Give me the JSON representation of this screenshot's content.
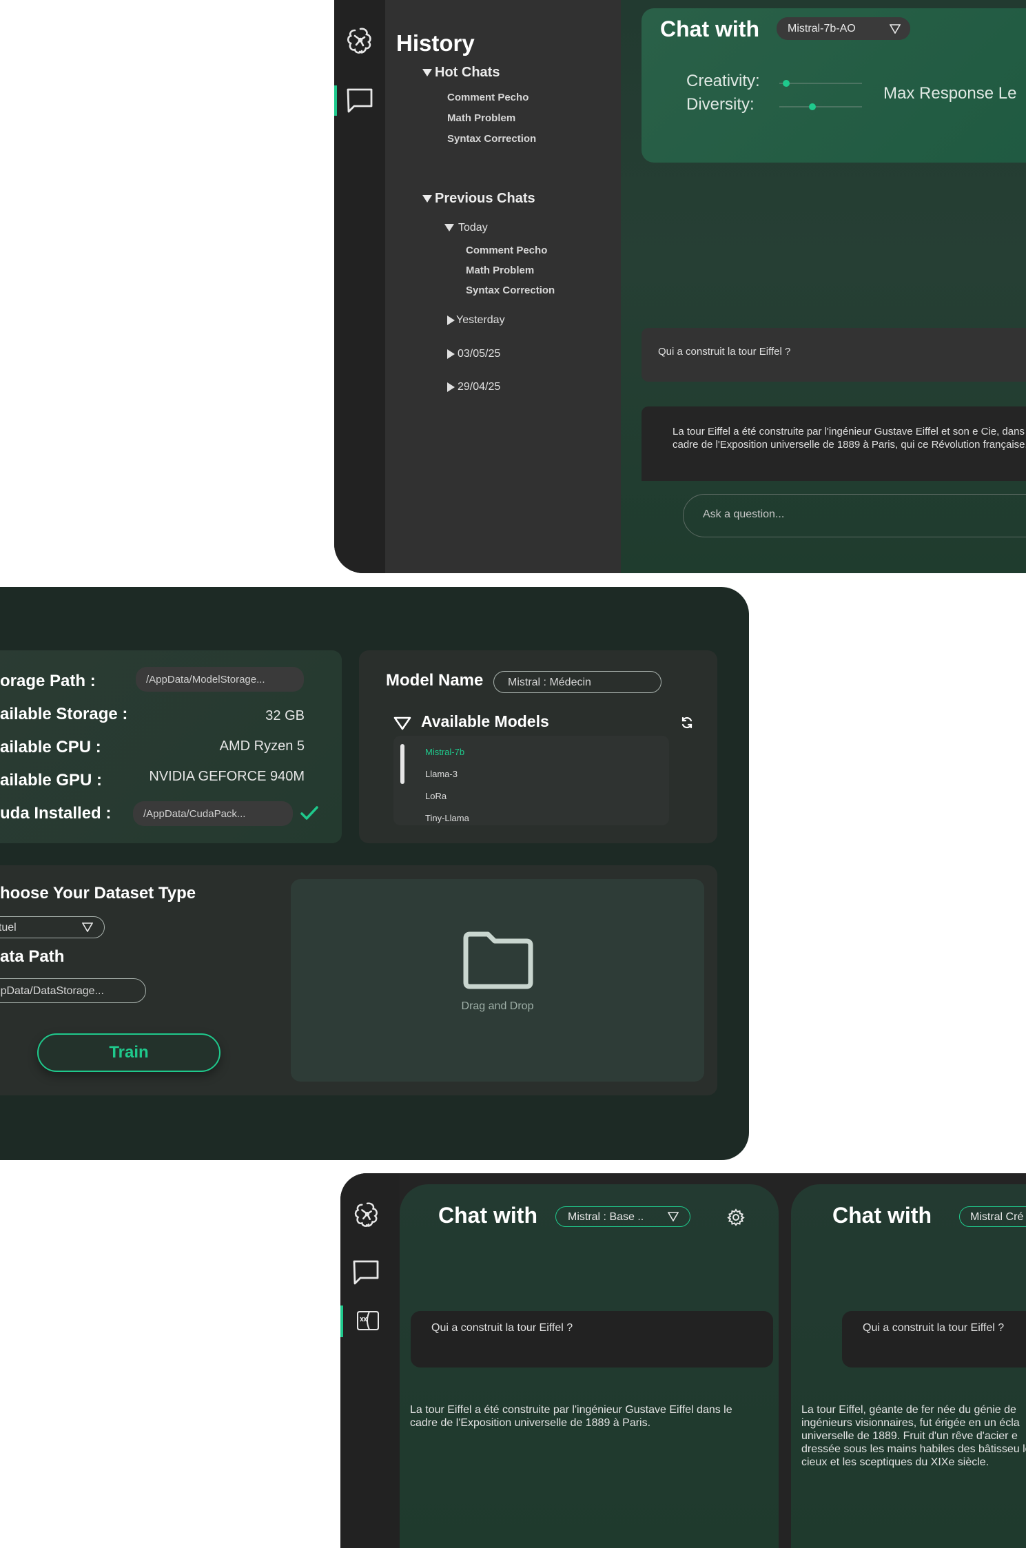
{
  "panel1": {
    "history_title": "History",
    "hot_chats_label": "Hot Chats",
    "hot_chats": [
      "Comment Pecho",
      "Math Problem",
      "Syntax Correction"
    ],
    "previous_chats_label": "Previous Chats",
    "today_label": "Today",
    "today_chats": [
      "Comment Pecho",
      "Math Problem",
      "Syntax Correction"
    ],
    "groups": [
      "Yesterday",
      "03/05/25",
      "29/04/25"
    ],
    "chat_with": "Chat with",
    "model_select": "Mistral-7b-AO",
    "creativity_label": "Creativity:",
    "diversity_label": "Diversity:",
    "max_response_label": "Max Response Le",
    "user_message": "Qui a construit la tour Eiffel ?",
    "assistant_message": "La tour Eiffel a été construite par l'ingénieur Gustave Eiffel et son e Cie, dans le cadre de l'Exposition universelle de 1889 à Paris, qui ce Révolution française.",
    "input_placeholder": "Ask a question...",
    "accent": "#1fc98c"
  },
  "panel2": {
    "storage_path_label": "orage Path :",
    "storage_path_value": "/AppData/ModelStorage...",
    "available_storage_label": "ailable Storage :",
    "available_storage_value": "32 GB",
    "available_cpu_label": "ailable CPU :",
    "available_cpu_value": "AMD Ryzen 5",
    "available_gpu_label": "ailable GPU :",
    "available_gpu_value": "NVIDIA GEFORCE 940M",
    "cuda_label": "uda Installed :",
    "cuda_value": "/AppData/CudaPack...",
    "model_name_label": "Model Name",
    "model_name_value": "Mistral : Médecin",
    "available_models_label": "Available Models",
    "models": [
      "Mistral-7b",
      "Llama-3",
      "LoRa",
      "Tiny-Llama"
    ],
    "selected_model": "Mistral-7b",
    "dataset_type_label": "hoose Your Dataset Type",
    "dataset_type_value": "extuel",
    "data_path_label": "ata Path",
    "data_path_value": "AppData/DataStorage...",
    "train_label": "Train",
    "drop_label": "Drag and Drop"
  },
  "panel3": {
    "left": {
      "chat_with": "Chat with",
      "model_select": "Mistral : Base ..",
      "user_message": "Qui a construit la tour Eiffel ?",
      "reply": "La tour Eiffel a été construite par l'ingénieur Gustave Eiffel dans le cadre de l'Exposition universelle de 1889 à Paris."
    },
    "right": {
      "chat_with": "Chat with",
      "model_select": "Mistral Cré",
      "user_message": "Qui a construit la tour Eiffel ?",
      "reply": "La tour Eiffel, géante de fer née du génie de ingénieurs visionnaires, fut érigée en un écla universelle de 1889. Fruit d'un rêve d'acier e dressée sous les mains habiles des bâtisseu les cieux et les sceptiques du XIXe siècle."
    }
  },
  "icons": {
    "brain": "brain-icon",
    "chat": "chat-bubble-icon",
    "dataset": "dataset-icon",
    "gear": "gear-icon",
    "refresh": "refresh-icon",
    "check": "check-icon",
    "folder": "folder-icon"
  }
}
